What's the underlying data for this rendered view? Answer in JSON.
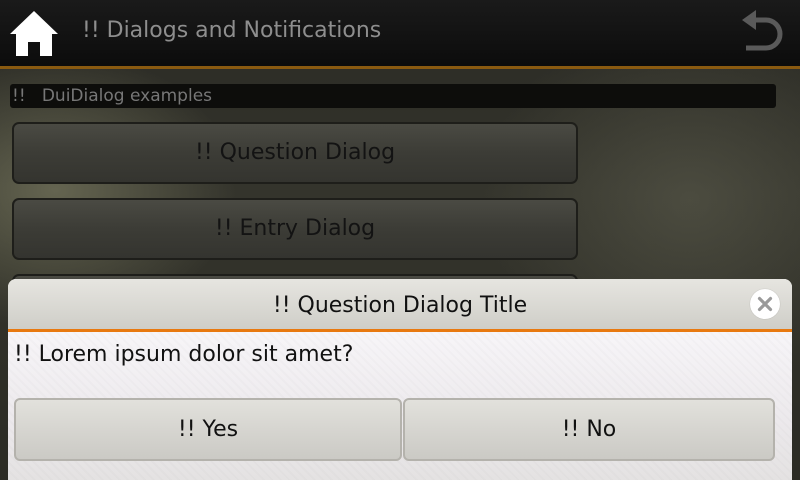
{
  "header": {
    "title": "!! Dialogs and Notifications",
    "home_icon": "home-icon",
    "back_icon": "back-icon"
  },
  "main": {
    "group_label": "!!   DuiDialog examples",
    "buttons": [
      {
        "label": "!! Question Dialog"
      },
      {
        "label": "!! Entry Dialog"
      },
      {
        "label": ""
      }
    ]
  },
  "dialog": {
    "title": "!! Question Dialog Title",
    "message": "!! Lorem ipsum dolor sit amet?",
    "yes_label": "!! Yes",
    "no_label": "!! No",
    "close_icon": "close-icon",
    "accent_color": "#e87910"
  }
}
